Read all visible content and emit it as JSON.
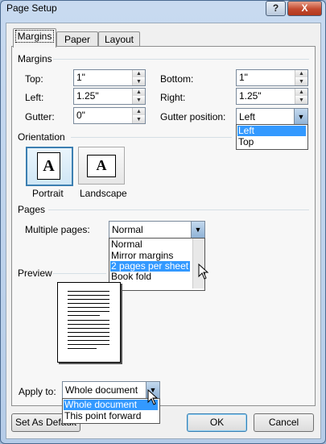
{
  "window": {
    "title": "Page Setup",
    "help": "?",
    "close": "X"
  },
  "tabs": [
    {
      "label": "Margins"
    },
    {
      "label": "Paper"
    },
    {
      "label": "Layout"
    }
  ],
  "margins": {
    "section": "Margins",
    "top": {
      "label": "Top:",
      "value": "1\""
    },
    "left": {
      "label": "Left:",
      "value": "1.25\""
    },
    "gutter": {
      "label": "Gutter:",
      "value": "0\""
    },
    "bottom": {
      "label": "Bottom:",
      "value": "1\""
    },
    "right": {
      "label": "Right:",
      "value": "1.25\""
    },
    "gutter_position": {
      "label": "Gutter position:",
      "value": "Left",
      "options": [
        "Left",
        "Top"
      ]
    }
  },
  "orientation": {
    "section": "Orientation",
    "portrait": "Portrait",
    "landscape": "Landscape",
    "glyph": "A"
  },
  "pages": {
    "section": "Pages",
    "label": "Multiple pages:",
    "value": "Normal",
    "options": [
      "Normal",
      "Mirror margins",
      "2 pages per sheet",
      "Book fold"
    ]
  },
  "preview": {
    "section": "Preview"
  },
  "apply": {
    "label": "Apply to:",
    "value": "Whole document",
    "options": [
      "Whole document",
      "This point forward"
    ]
  },
  "buttons": {
    "default": "Set As Default",
    "ok": "OK",
    "cancel": "Cancel"
  }
}
